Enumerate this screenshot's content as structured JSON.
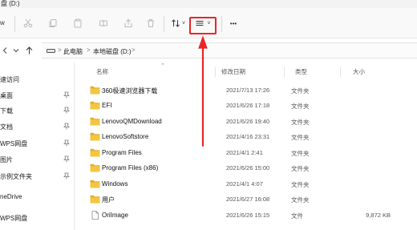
{
  "window": {
    "title_fragment": "盘 (D:)"
  },
  "toolbar": {
    "new_fragment": "w",
    "buttons": [
      {
        "name": "cut-icon"
      },
      {
        "name": "copy-icon"
      },
      {
        "name": "paste-icon"
      },
      {
        "name": "rename-icon"
      },
      {
        "name": "share-icon"
      },
      {
        "name": "delete-icon"
      },
      {
        "name": "sort-icon",
        "caret": "˅"
      },
      {
        "name": "view-icon",
        "caret": "˅"
      },
      {
        "name": "more-icon"
      }
    ],
    "more_label": "•••"
  },
  "addressbar": {
    "crumbs": [
      "此电脑",
      "本地磁盘 (D:)"
    ],
    "separator": ">"
  },
  "sidebar": {
    "items": [
      {
        "label": "速访问",
        "pinned": false
      },
      {
        "label": "桌面",
        "pinned": true
      },
      {
        "label": "下载",
        "pinned": true
      },
      {
        "label": "文档",
        "pinned": true
      },
      {
        "label": "WPS网盘",
        "pinned": true
      },
      {
        "label": "图片",
        "pinned": true
      },
      {
        "label": "示例文件夹",
        "pinned": true
      },
      {
        "label": "neDrive",
        "pinned": false
      },
      {
        "label": "",
        "pinned": false
      },
      {
        "label": "WPS网盘",
        "pinned": false
      }
    ]
  },
  "filelist": {
    "columns": {
      "name": "名称",
      "date": "修改日期",
      "type": "类型",
      "size": "大小"
    },
    "rows": [
      {
        "name": "360极速浏览器下载",
        "date": "2021/7/13 17:26",
        "type": "文件夹",
        "size": "",
        "kind": "folder"
      },
      {
        "name": "EFI",
        "date": "2021/6/26 17:18",
        "type": "文件夹",
        "size": "",
        "kind": "folder"
      },
      {
        "name": "LenovoQMDownload",
        "date": "2021/6/26 19:40",
        "type": "文件夹",
        "size": "",
        "kind": "folder"
      },
      {
        "name": "LenovoSoftstore",
        "date": "2021/4/16 23:31",
        "type": "文件夹",
        "size": "",
        "kind": "folder"
      },
      {
        "name": "Program Files",
        "date": "2021/4/1 2:41",
        "type": "文件夹",
        "size": "",
        "kind": "folder"
      },
      {
        "name": "Program Files (x86)",
        "date": "2021/6/26 15:00",
        "type": "文件夹",
        "size": "",
        "kind": "folder"
      },
      {
        "name": "Windows",
        "date": "2021/4/1 4:07",
        "type": "文件夹",
        "size": "",
        "kind": "folder"
      },
      {
        "name": "用户",
        "date": "2021/6/27 16:08",
        "type": "文件夹",
        "size": "",
        "kind": "folder"
      },
      {
        "name": "OriImage",
        "date": "2021/6/26 15:15",
        "type": "文件",
        "size": "9,872 KB",
        "kind": "file"
      }
    ]
  },
  "colors": {
    "annotation": "#e8262b",
    "folder": "#f4c542",
    "folder_dark": "#e2ad2a"
  }
}
